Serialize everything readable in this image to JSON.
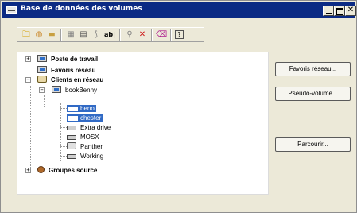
{
  "window": {
    "title": "Base de données des volumes",
    "controls": {
      "minimize": "",
      "maximize": "",
      "close": "✕"
    }
  },
  "toolbar": {
    "icons": [
      "folder-icon",
      "open-icon",
      "folder-closed-icon",
      "grid-icon",
      "properties-icon",
      "link-icon",
      "rename-icon",
      "filter-icon",
      "delete-icon",
      "erase-icon",
      "help-icon"
    ],
    "glyphs": {
      "folder": "🗀",
      "open": "◍",
      "folder_closed": "▬",
      "grid": "▦",
      "properties": "▤",
      "link": "⟆",
      "rename": "ab|",
      "filter": "⚲",
      "delete": "✕",
      "erase": "⌫",
      "help": "?"
    },
    "delete_color": "#cc1010"
  },
  "tree": {
    "workstation": "Poste de travail",
    "favorites": "Favoris réseau",
    "network_clients": "Clients en réseau",
    "bookbenny": "bookBenny",
    "items": [
      "beno",
      "chester",
      "Extra drive",
      "MOSX",
      "Panther",
      "Working"
    ],
    "source_groups": "Groupes source",
    "selected_color": "#316ac5"
  },
  "buttons": {
    "favorites": "Favoris réseau...",
    "pseudo_volume": "Pseudo-volume...",
    "browse": "Parcourir..."
  }
}
